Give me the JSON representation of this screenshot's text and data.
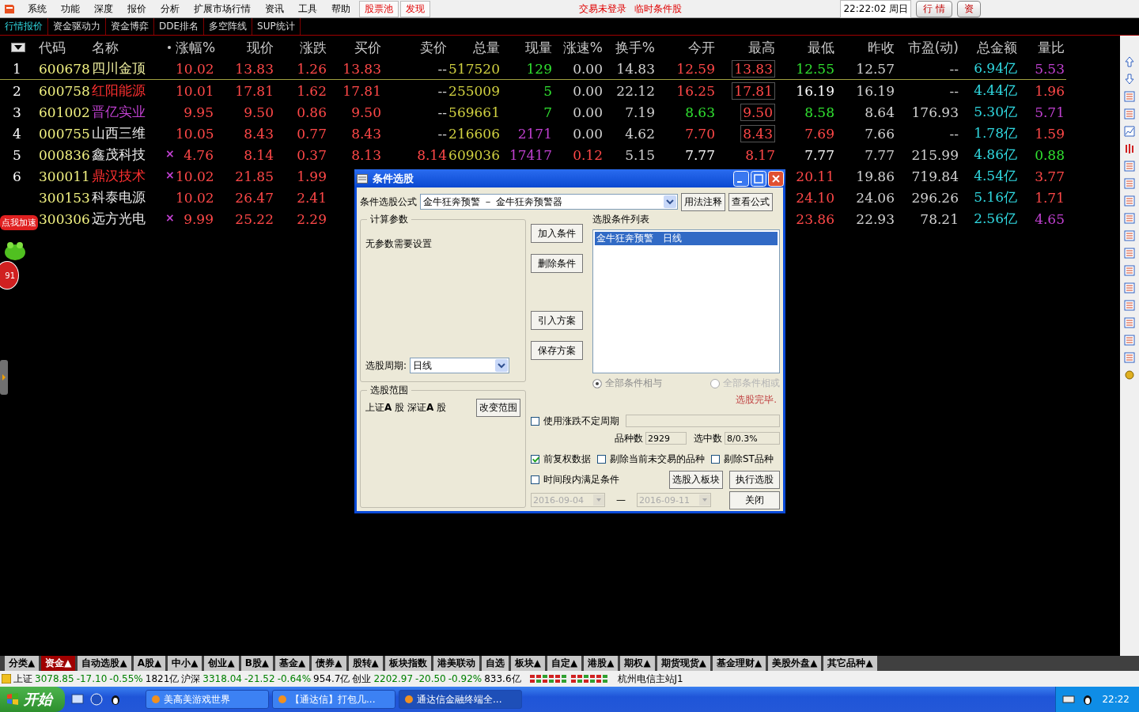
{
  "menu": {
    "items": [
      "系统",
      "功能",
      "深度",
      "报价",
      "分析",
      "扩展市场行情",
      "资讯",
      "工具",
      "帮助"
    ],
    "pool_tabs": [
      "股票池",
      "发现"
    ],
    "notices": [
      "交易未登录",
      "临时条件股"
    ],
    "clock": "22:22:02 周日",
    "buttons": [
      "行 情",
      "资"
    ]
  },
  "tabs": [
    {
      "label": "行情报价",
      "selected": true
    },
    {
      "label": "资金驱动力",
      "selected": false
    },
    {
      "label": "资金博弈",
      "selected": false
    },
    {
      "label": "DDE排名",
      "selected": false
    },
    {
      "label": "多空阵线",
      "selected": false
    },
    {
      "label": "SUP统计",
      "selected": false
    }
  ],
  "table": {
    "columns": [
      "",
      "代码",
      "名称",
      "",
      "涨幅%",
      "现价",
      "涨跌",
      "买价",
      "卖价",
      "总量",
      "现量",
      "涨速%",
      "换手%",
      "今开",
      "最高",
      "最低",
      "昨收",
      "市盈(动)",
      "总金额",
      "量比"
    ],
    "rows": [
      {
        "cells": [
          {
            "text": "1",
            "color": "#ffffff"
          },
          {
            "text": "600678",
            "color": "#f0f080"
          },
          {
            "text": "四川金顶",
            "color": "#f0f0a0"
          },
          null,
          {
            "text": "10.02",
            "color": "#ff4848"
          },
          {
            "text": "13.83",
            "color": "#ff4848"
          },
          {
            "text": "1.26",
            "color": "#ff4848"
          },
          {
            "text": "13.83",
            "color": "#ff4848"
          },
          {
            "text": "--",
            "color": "#d0d0d0"
          },
          {
            "text": "517520",
            "color": "#d0d040"
          },
          {
            "text": "129",
            "color": "#30e030"
          },
          {
            "text": "0.00",
            "color": "#d0d0d0"
          },
          {
            "text": "14.83",
            "color": "#d0d0d0"
          },
          {
            "text": "12.59",
            "color": "#ff4848"
          },
          {
            "text": "13.83",
            "color": "#ff4848",
            "boxed": true
          },
          {
            "text": "12.55",
            "color": "#30e030"
          },
          {
            "text": "12.57",
            "color": "#d0d0d0"
          },
          {
            "text": "--",
            "color": "#d0d0d0"
          },
          {
            "text": "6.94亿",
            "color": "#30d8e0"
          },
          {
            "text": "5.53",
            "color": "#c040d0"
          }
        ]
      },
      {
        "cells": [
          {
            "text": "2",
            "color": "#ffffff"
          },
          {
            "text": "600758",
            "color": "#f0f080"
          },
          {
            "text": "红阳能源",
            "color": "#ff3030"
          },
          null,
          {
            "text": "10.01",
            "color": "#ff4848"
          },
          {
            "text": "17.81",
            "color": "#ff4848"
          },
          {
            "text": "1.62",
            "color": "#ff4848"
          },
          {
            "text": "17.81",
            "color": "#ff4848"
          },
          {
            "text": "--",
            "color": "#d0d0d0"
          },
          {
            "text": "255009",
            "color": "#d0d040"
          },
          {
            "text": "5",
            "color": "#30e030"
          },
          {
            "text": "0.00",
            "color": "#d0d0d0"
          },
          {
            "text": "22.12",
            "color": "#d0d0d0"
          },
          {
            "text": "16.25",
            "color": "#ff4848"
          },
          {
            "text": "17.81",
            "color": "#ff4848",
            "boxed": true
          },
          {
            "text": "16.19",
            "color": "#ffffff"
          },
          {
            "text": "16.19",
            "color": "#d0d0d0"
          },
          {
            "text": "--",
            "color": "#d0d0d0"
          },
          {
            "text": "4.44亿",
            "color": "#30d8e0"
          },
          {
            "text": "1.96",
            "color": "#ff4848"
          }
        ]
      },
      {
        "cells": [
          {
            "text": "3",
            "color": "#ffffff"
          },
          {
            "text": "601002",
            "color": "#f0f080"
          },
          {
            "text": "晋亿实业",
            "color": "#c040d0"
          },
          null,
          {
            "text": "9.95",
            "color": "#ff4848"
          },
          {
            "text": "9.50",
            "color": "#ff4848"
          },
          {
            "text": "0.86",
            "color": "#ff4848"
          },
          {
            "text": "9.50",
            "color": "#ff4848"
          },
          {
            "text": "--",
            "color": "#d0d0d0"
          },
          {
            "text": "569661",
            "color": "#d0d040"
          },
          {
            "text": "7",
            "color": "#30e030"
          },
          {
            "text": "0.00",
            "color": "#d0d0d0"
          },
          {
            "text": "7.19",
            "color": "#d0d0d0"
          },
          {
            "text": "8.63",
            "color": "#30e030"
          },
          {
            "text": "9.50",
            "color": "#ff4848",
            "boxed": true
          },
          {
            "text": "8.58",
            "color": "#30e030"
          },
          {
            "text": "8.64",
            "color": "#d0d0d0"
          },
          {
            "text": "176.93",
            "color": "#d0d0d0"
          },
          {
            "text": "5.30亿",
            "color": "#30d8e0"
          },
          {
            "text": "5.71",
            "color": "#c040d0"
          }
        ]
      },
      {
        "cells": [
          {
            "text": "4",
            "color": "#ffffff"
          },
          {
            "text": "000755",
            "color": "#f0f080"
          },
          {
            "text": "山西三维",
            "color": "#e8e8e8"
          },
          null,
          {
            "text": "10.05",
            "color": "#ff4848"
          },
          {
            "text": "8.43",
            "color": "#ff4848"
          },
          {
            "text": "0.77",
            "color": "#ff4848"
          },
          {
            "text": "8.43",
            "color": "#ff4848"
          },
          {
            "text": "--",
            "color": "#d0d0d0"
          },
          {
            "text": "216606",
            "color": "#d0d040"
          },
          {
            "text": "2171",
            "color": "#c040d0"
          },
          {
            "text": "0.00",
            "color": "#d0d0d0"
          },
          {
            "text": "4.62",
            "color": "#d0d0d0"
          },
          {
            "text": "7.70",
            "color": "#ff4848"
          },
          {
            "text": "8.43",
            "color": "#ff4848",
            "boxed": true
          },
          {
            "text": "7.69",
            "color": "#ff4848"
          },
          {
            "text": "7.66",
            "color": "#d0d0d0"
          },
          {
            "text": "--",
            "color": "#d0d0d0"
          },
          {
            "text": "1.78亿",
            "color": "#30d8e0"
          },
          {
            "text": "1.59",
            "color": "#ff4848"
          }
        ]
      },
      {
        "cells": [
          {
            "text": "5",
            "color": "#ffffff"
          },
          {
            "text": "000836",
            "color": "#f0f080"
          },
          {
            "text": "鑫茂科技",
            "color": "#e8e8e8"
          },
          {
            "text": "×",
            "color": "#c040d0"
          },
          {
            "text": "4.76",
            "color": "#ff4848"
          },
          {
            "text": "8.14",
            "color": "#ff4848"
          },
          {
            "text": "0.37",
            "color": "#ff4848"
          },
          {
            "text": "8.13",
            "color": "#ff4848"
          },
          {
            "text": "8.14",
            "color": "#ff4848"
          },
          {
            "text": "609036",
            "color": "#d0d040"
          },
          {
            "text": "17417",
            "color": "#c040d0"
          },
          {
            "text": "0.12",
            "color": "#ff4848"
          },
          {
            "text": "5.15",
            "color": "#d0d0d0"
          },
          {
            "text": "7.77",
            "color": "#ffffff"
          },
          {
            "text": "8.17",
            "color": "#ff4848"
          },
          {
            "text": "7.77",
            "color": "#ffffff"
          },
          {
            "text": "7.77",
            "color": "#d0d0d0"
          },
          {
            "text": "215.99",
            "color": "#d0d0d0"
          },
          {
            "text": "4.86亿",
            "color": "#30d8e0"
          },
          {
            "text": "0.88",
            "color": "#30e030"
          }
        ]
      },
      {
        "cells": [
          {
            "text": "6",
            "color": "#ffffff"
          },
          {
            "text": "300011",
            "color": "#f0f080"
          },
          {
            "text": "鼎汉技术",
            "color": "#ff3030"
          },
          {
            "text": "×",
            "color": "#c040d0"
          },
          {
            "text": "10.02",
            "color": "#ff4848"
          },
          {
            "text": "21.85",
            "color": "#ff4848"
          },
          {
            "text": "1.99",
            "color": "#ff4848"
          },
          null,
          null,
          null,
          null,
          null,
          null,
          null,
          null,
          {
            "text": "20.11",
            "color": "#ff4848"
          },
          {
            "text": "19.86",
            "color": "#d0d0d0"
          },
          {
            "text": "719.84",
            "color": "#d0d0d0"
          },
          {
            "text": "4.54亿",
            "color": "#30d8e0"
          },
          {
            "text": "3.77",
            "color": "#ff4848"
          }
        ]
      },
      {
        "cells": [
          null,
          {
            "text": "300153",
            "color": "#f0f080"
          },
          {
            "text": "科泰电源",
            "color": "#e8e8e8"
          },
          null,
          {
            "text": "10.02",
            "color": "#ff4848"
          },
          {
            "text": "26.47",
            "color": "#ff4848"
          },
          {
            "text": "2.41",
            "color": "#ff4848"
          },
          null,
          null,
          null,
          null,
          null,
          null,
          null,
          null,
          {
            "text": "24.10",
            "color": "#ff4848"
          },
          {
            "text": "24.06",
            "color": "#d0d0d0"
          },
          {
            "text": "296.26",
            "color": "#d0d0d0"
          },
          {
            "text": "5.16亿",
            "color": "#30d8e0"
          },
          {
            "text": "1.71",
            "color": "#ff4848"
          }
        ]
      },
      {
        "cells": [
          null,
          {
            "text": "300306",
            "color": "#f0f080"
          },
          {
            "text": "远方光电",
            "color": "#e8e8e8"
          },
          {
            "text": "×",
            "color": "#c040d0"
          },
          {
            "text": "9.99",
            "color": "#ff4848"
          },
          {
            "text": "25.22",
            "color": "#ff4848"
          },
          {
            "text": "2.29",
            "color": "#ff4848"
          },
          null,
          null,
          null,
          null,
          null,
          null,
          null,
          null,
          {
            "text": "23.86",
            "color": "#ff4848"
          },
          {
            "text": "22.93",
            "color": "#d0d0d0"
          },
          {
            "text": "78.21",
            "color": "#d0d0d0"
          },
          {
            "text": "2.56亿",
            "color": "#30d8e0"
          },
          {
            "text": "4.65",
            "color": "#c040d0"
          }
        ]
      }
    ]
  },
  "float_badge": {
    "label": "点我加速",
    "count": "91"
  },
  "dialog": {
    "title": "条件选股",
    "formula_label": "条件选股公式",
    "formula": "金牛狂奔预警 － 金牛狂奔预警器",
    "help_button": "用法注释",
    "view_button": "查看公式",
    "params_title": "计算参数",
    "params_text": "无参数需要设置",
    "period_label": "选股周期:",
    "period": "日线",
    "action_buttons": [
      "加入条件",
      "删除条件",
      "引入方案",
      "保存方案"
    ],
    "list_title": "选股条件列表",
    "conditions": [
      {
        "text": "金牛狂奔预警　日线",
        "selected": true
      }
    ],
    "radios": [
      {
        "label": "全部条件相与",
        "selected": true
      },
      {
        "label": "全部条件相或",
        "selected": false
      }
    ],
    "range_title": "选股范围",
    "range_text": "上证**A** 股  深证**A** 股",
    "range_button": "改变范围",
    "status": "选股完毕.",
    "variable_period": {
      "label": "使用涨跌不定周期",
      "checked": false
    },
    "count_label": "品种数",
    "count": "2929",
    "hit_label": "选中数",
    "hit": "8/0.3%",
    "options": [
      {
        "label": "前复权数据",
        "checked": true
      },
      {
        "label": "剔除当前未交易的品种",
        "checked": false
      },
      {
        "label": "剔除ST品种",
        "checked": false
      }
    ],
    "time_option": {
      "label": "时间段内满足条件",
      "checked": false
    },
    "to_block_button": "选股入板块",
    "run_button": "执行选股",
    "date_from": "2016-09-04",
    "dash": "—",
    "date_to": "2016-09-11",
    "close_button": "关闭"
  },
  "bottom_tabs": [
    {
      "label": "分类▲",
      "selected": false
    },
    {
      "label": "资金▲",
      "selected": true
    },
    {
      "label": "自动选股▲",
      "selected": false
    },
    {
      "label": "A股▲",
      "selected": false
    },
    {
      "label": "中小▲",
      "selected": false
    },
    {
      "label": "创业▲",
      "selected": false
    },
    {
      "label": "B股▲",
      "selected": false
    },
    {
      "label": "基金▲",
      "selected": false
    },
    {
      "label": "债券▲",
      "selected": false
    },
    {
      "label": "股转▲",
      "selected": false
    },
    {
      "label": "板块指数",
      "selected": false
    },
    {
      "label": "港美联动",
      "selected": false
    },
    {
      "label": "自选",
      "selected": false
    },
    {
      "label": "板块▲",
      "selected": false
    },
    {
      "label": "自定▲",
      "selected": false
    },
    {
      "label": "港股▲",
      "selected": false
    },
    {
      "label": "期权▲",
      "selected": false
    },
    {
      "label": "期货现货▲",
      "selected": false
    },
    {
      "label": "基金理财▲",
      "selected": false
    },
    {
      "label": "美股外盘▲",
      "selected": false
    },
    {
      "label": "其它品种▲",
      "selected": false
    }
  ],
  "status_bar": {
    "indices": [
      {
        "name": "上证",
        "value": "3078.85",
        "change": "-17.10",
        "pct": "-0.55%",
        "amount": "1821亿"
      },
      {
        "name": "沪深",
        "value": "3318.04",
        "change": "-21.52",
        "pct": "-0.64%",
        "amount": "954.7亿"
      },
      {
        "name": "创业",
        "value": "2202.97",
        "change": "-20.50",
        "pct": "-0.92%",
        "amount": "833.6亿"
      }
    ],
    "server": "杭州电信主站J1"
  },
  "taskbar": {
    "start": "开始",
    "windows": [
      {
        "label": "美高美游戏世界",
        "selected": false
      },
      {
        "label": "【通达信】打包几...",
        "selected": false
      },
      {
        "label": "通达信金融终端全...",
        "selected": true
      }
    ],
    "time": "22:22"
  }
}
